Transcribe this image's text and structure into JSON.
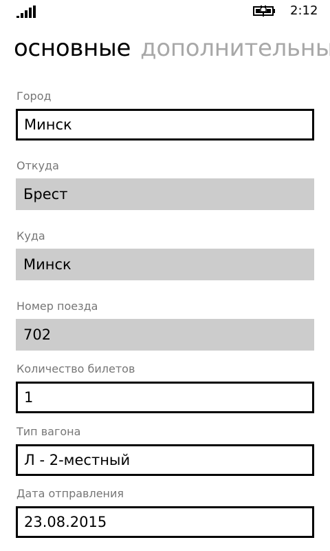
{
  "status_bar": {
    "time": "2:12",
    "signal_icon": "signal-strength-icon",
    "battery_icon": "battery-charging-icon"
  },
  "pivot": {
    "tabs": [
      {
        "label": "основные",
        "active": true
      },
      {
        "label": "дополнительные",
        "active": false
      }
    ]
  },
  "form": {
    "city": {
      "label": "Город",
      "value": "Минск"
    },
    "from": {
      "label": "Откуда",
      "value": "Брест"
    },
    "to": {
      "label": "Куда",
      "value": "Минск"
    },
    "train_number": {
      "label": "Номер поезда",
      "value": "702"
    },
    "tickets": {
      "label": "Количество билетов",
      "value": "1"
    },
    "car_type": {
      "label": "Тип вагона",
      "value": "Л - 2-местный"
    },
    "departure_date": {
      "label": "Дата отправления",
      "value": "23.08.2015"
    }
  },
  "colors": {
    "label": "#767676",
    "inactive_tab": "#a8a8a8",
    "readonly_bg": "#cccccc",
    "border": "#000000"
  }
}
